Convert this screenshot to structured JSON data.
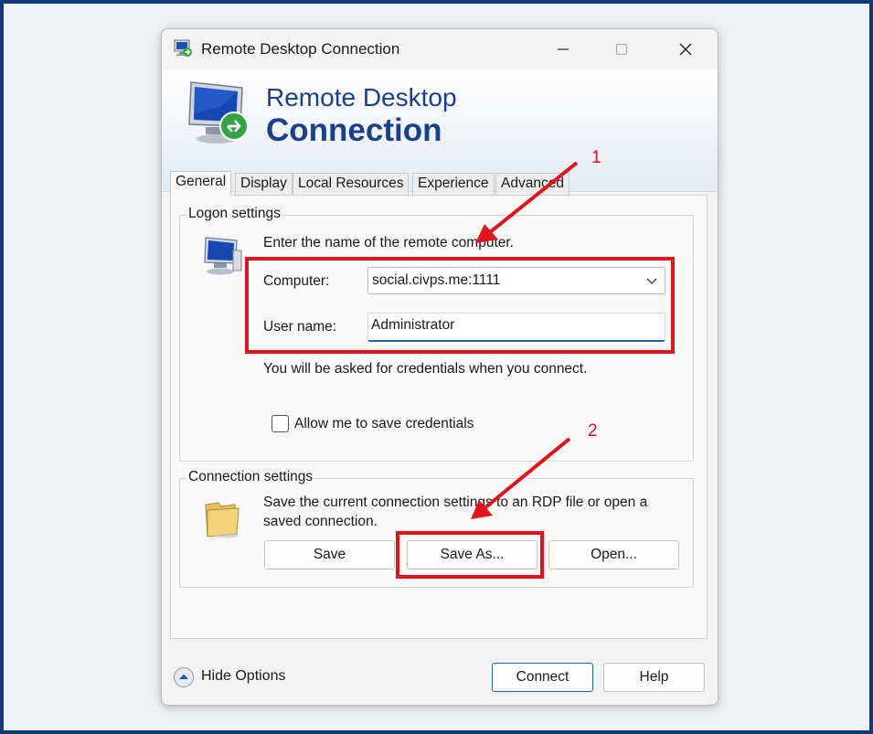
{
  "window": {
    "title": "Remote Desktop Connection",
    "banner_line1": "Remote Desktop",
    "banner_line2": "Connection"
  },
  "tabs": [
    {
      "label": "General",
      "active": true
    },
    {
      "label": "Display",
      "active": false
    },
    {
      "label": "Local Resources",
      "active": false
    },
    {
      "label": "Experience",
      "active": false
    },
    {
      "label": "Advanced",
      "active": false
    }
  ],
  "logon": {
    "group_label": "Logon settings",
    "instruction": "Enter the name of the remote computer.",
    "computer_label": "Computer:",
    "computer_value": "social.civps.me:1111",
    "username_label": "User name:",
    "username_value": "Administrator",
    "credentials_note": "You will be asked for credentials when you connect.",
    "save_credentials_label": "Allow me to save credentials",
    "save_credentials_checked": false
  },
  "connection": {
    "group_label": "Connection settings",
    "description_line1": "Save the current connection settings to an RDP file or open a",
    "description_line2": "saved connection.",
    "save_label": "Save",
    "save_as_label": "Save As...",
    "open_label": "Open..."
  },
  "footer": {
    "hide_options_label": "Hide Options",
    "connect_label": "Connect",
    "help_label": "Help"
  },
  "annotations": {
    "callout_1": "1",
    "callout_2": "2",
    "color": "#e3121c"
  },
  "icons": [
    "rdp-computer-icon",
    "minimize-icon",
    "maximize-icon",
    "close-icon",
    "monitor-icon",
    "folder-icon",
    "chevron-down-icon",
    "chevron-up-icon"
  ],
  "colors": {
    "frame_border": "#103a78",
    "banner_text": "#1b3f8c",
    "accent": "#1f5fae"
  }
}
